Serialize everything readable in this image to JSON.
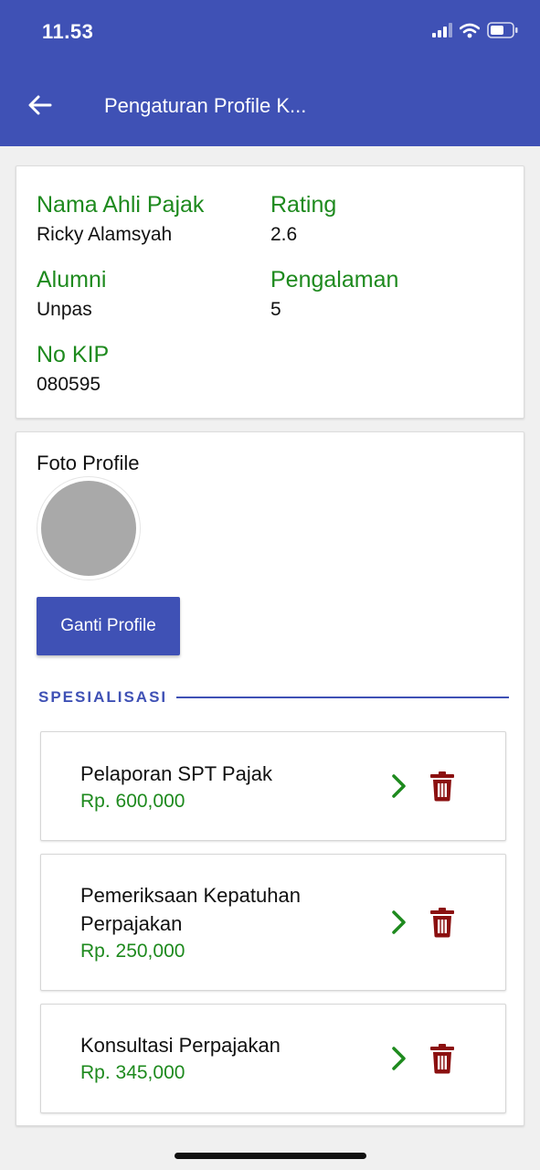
{
  "status_bar": {
    "time": "11.53"
  },
  "appbar": {
    "title": "Pengaturan Profile K..."
  },
  "info": {
    "name_label": "Nama Ahli Pajak",
    "name_value": "Ricky Alamsyah",
    "rating_label": "Rating",
    "rating_value": "2.6",
    "alumni_label": "Alumni",
    "alumni_value": "Unpas",
    "experience_label": "Pengalaman",
    "experience_value": "5",
    "kip_label": "No KIP",
    "kip_value": "080595"
  },
  "profile": {
    "photo_label": "Foto Profile",
    "change_button": "Ganti Profile"
  },
  "specialization": {
    "title": "SPESIALISASI",
    "items": [
      {
        "name": "Pelaporan SPT Pajak",
        "price": "Rp. 600,000"
      },
      {
        "name": "Pemeriksaan Kepatuhan Perpajakan",
        "price": "Rp. 250,000"
      },
      {
        "name": "Konsultasi Perpajakan",
        "price": "Rp. 345,000"
      }
    ]
  },
  "colors": {
    "primary": "#3f51b5",
    "label_green": "#1e8a1e",
    "delete_red": "#8b1010"
  },
  "icons": [
    "back-arrow-icon",
    "signal-icon",
    "wifi-icon",
    "battery-icon",
    "chevron-right-icon",
    "trash-icon"
  ]
}
